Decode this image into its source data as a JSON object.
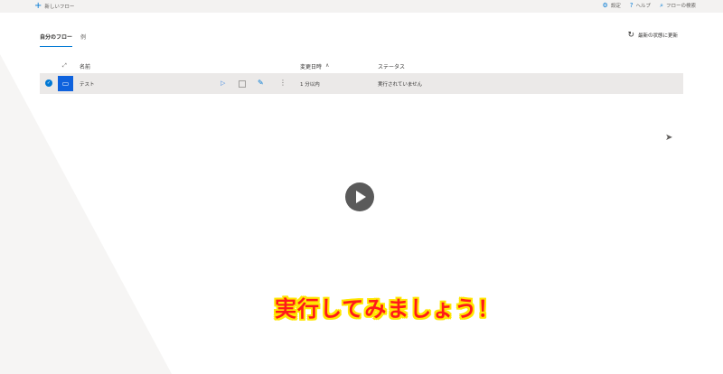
{
  "topbar": {
    "new_flow_label": "新しいフロー",
    "settings_label": "設定",
    "help_label": "ヘルプ",
    "search_label": "フローの検索"
  },
  "tabs": [
    {
      "label": "自分のフロー",
      "active": true
    },
    {
      "label": "例",
      "active": false
    }
  ],
  "refresh_label": "最新の状態に更新",
  "table": {
    "headers": {
      "name": "名前",
      "modified": "変更日時",
      "status": "ステータス"
    },
    "rows": [
      {
        "name": "テスト",
        "modified": "1 分以内",
        "status": "実行されていません"
      }
    ]
  },
  "caption": "実行してみましょう！",
  "colors": {
    "accent": "#0078d4",
    "caption_text": "#ff1a1a",
    "caption_outline": "#ffe600",
    "selected_row_bg": "#ebe9e8"
  },
  "icons": {
    "add": "plus-icon",
    "settings": "gear-icon",
    "help": "question-icon",
    "search": "search-icon",
    "refresh": "refresh-icon",
    "flow": "desktop-flow-icon",
    "run": "play-icon",
    "stop": "stop-icon",
    "edit": "pencil-icon",
    "more": "more-vertical-icon",
    "video_play": "play-circle-icon"
  }
}
